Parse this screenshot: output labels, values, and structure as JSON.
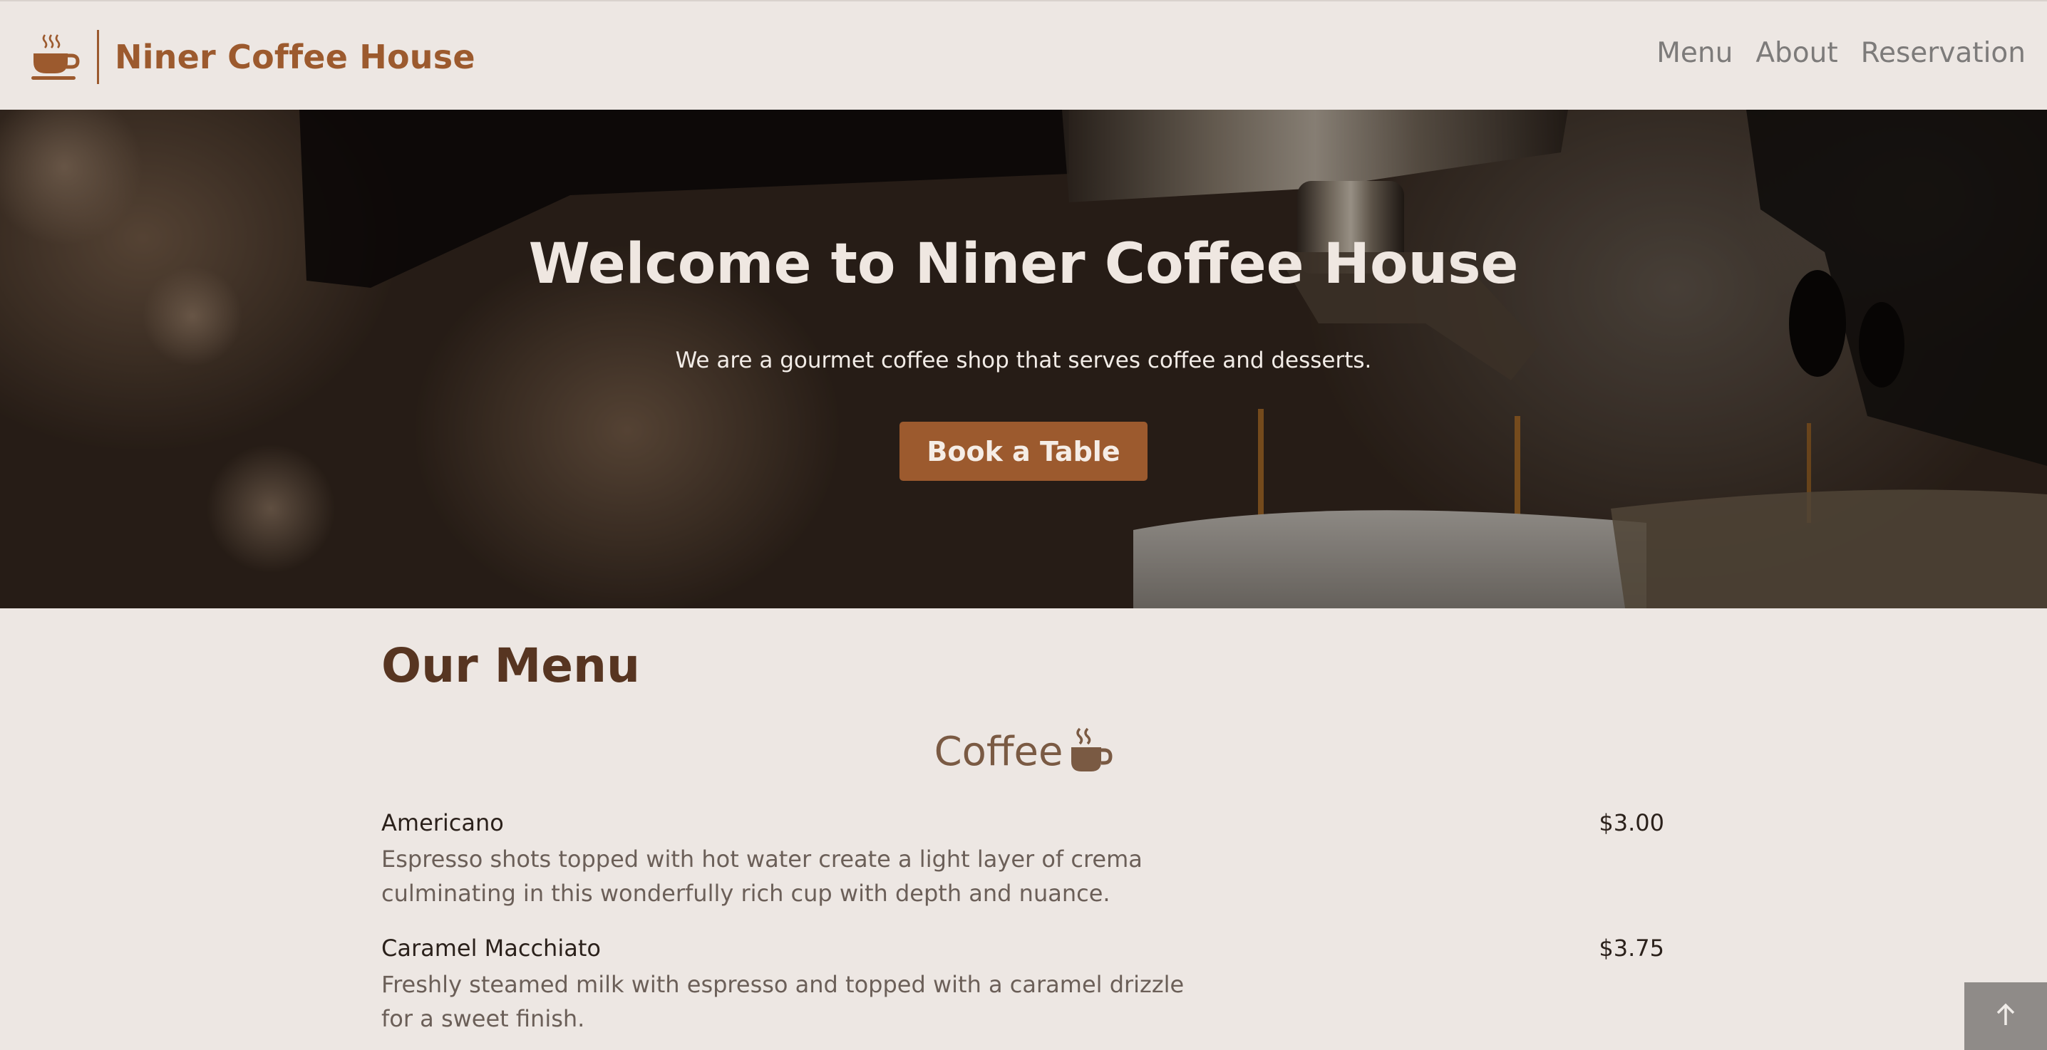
{
  "header": {
    "brand_icon": "coffee-cup-icon",
    "brand_title": "Niner Coffee House",
    "nav": [
      {
        "label": "Menu"
      },
      {
        "label": "About"
      },
      {
        "label": "Reservation"
      }
    ]
  },
  "hero": {
    "title": "Welcome to Niner Coffee House",
    "subtitle": "We are a gourmet coffee shop that serves coffee and desserts.",
    "button_label": "Book a Table",
    "background": "espresso-machine-photo"
  },
  "menu": {
    "heading": "Our Menu",
    "category": {
      "label": "Coffee",
      "icon": "coffee-cup-icon"
    },
    "items": [
      {
        "name": "Americano",
        "price": "$3.00",
        "description": "Espresso shots topped with hot water create a light layer of crema culminating in this wonderfully rich cup with depth and nuance."
      },
      {
        "name": "Caramel Macchiato",
        "price": "$3.75",
        "description": "Freshly steamed milk with espresso and topped with a caramel drizzle for a sweet finish."
      }
    ]
  },
  "back_to_top": {
    "icon": "arrow-up-icon"
  },
  "colors": {
    "accent": "#9c5a2e",
    "page_background": "#ede7e3",
    "heading": "#573521",
    "nav_text": "#7d7b7a"
  }
}
